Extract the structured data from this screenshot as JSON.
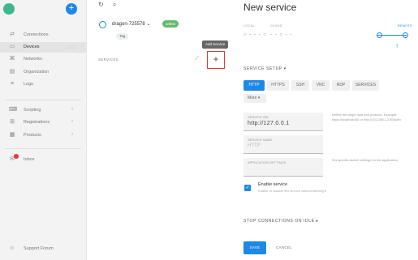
{
  "sidebar": {
    "items": [
      {
        "label": "Connections",
        "icon": "connections-icon",
        "glyph": "⇄"
      },
      {
        "label": "Devices",
        "icon": "devices-icon",
        "glyph": "▭"
      },
      {
        "label": "Networks",
        "icon": "networks-icon",
        "glyph": "⌘"
      },
      {
        "label": "Organization",
        "icon": "organization-icon",
        "glyph": "▤"
      },
      {
        "label": "Logs",
        "icon": "logs-icon",
        "glyph": "≡"
      },
      {
        "label": "Scripting",
        "icon": "scripting-icon",
        "glyph": "⌨"
      },
      {
        "label": "Registrations",
        "icon": "registrations-icon",
        "glyph": "⊞"
      },
      {
        "label": "Products",
        "icon": "products-icon",
        "glyph": "▦"
      },
      {
        "label": "Inbox",
        "icon": "inbox-icon",
        "glyph": "✉"
      },
      {
        "label": "Support Forum",
        "icon": "support-forum-icon",
        "glyph": "☺"
      }
    ],
    "fab": "+"
  },
  "middle": {
    "refresh_glyph": "↻",
    "search_glyph": "⌕",
    "device_name": "dragon-725578",
    "device_chevron": "⌄",
    "status": "online",
    "tag": "Tag",
    "services_label": "SERVICES",
    "trend_glyph": "⟋",
    "tooltip": "Add Service",
    "add_glyph": "+"
  },
  "form": {
    "title": "New service",
    "route": {
      "local_label": "LOCAL",
      "cloud_label": "CLOUD",
      "local_value": "○ - - - ○",
      "cloud_value": "- - ○ - -",
      "remote_label": "REMOTE",
      "arrow_glyph": "↑"
    },
    "service_setup": "SERVICE SETUP  ▾",
    "tabs": [
      "HTTP",
      "HTTPS",
      "SSH",
      "VNC",
      "RDP",
      "SERVICES"
    ],
    "dropdown": "More ▾",
    "service_url_label": "SERVICE URL",
    "service_url_value": "http://127.0.0.1",
    "service_url_hint": "Define the target host and protocol. Example: https://localhost:80 or http://192.168.1.2:80/path",
    "service_name_label": "SERVICE NAME",
    "service_name_placeholder": "HTTP",
    "attributes_label": "APPLICATION SETTINGS",
    "attributes_hint": "Set specific launch settings for the application",
    "enable_label": "Enable service",
    "enable_sub": "Enable or disable this service without deleting it",
    "connect_section": "STOP CONNECTIONS ON IDLE  ▸",
    "save": "SAVE",
    "cancel": "CANCEL"
  },
  "colors": {
    "accent": "#1e88e5",
    "online": "#66bb6a",
    "highlight": "#e53935",
    "logo": "#3fb68b"
  }
}
